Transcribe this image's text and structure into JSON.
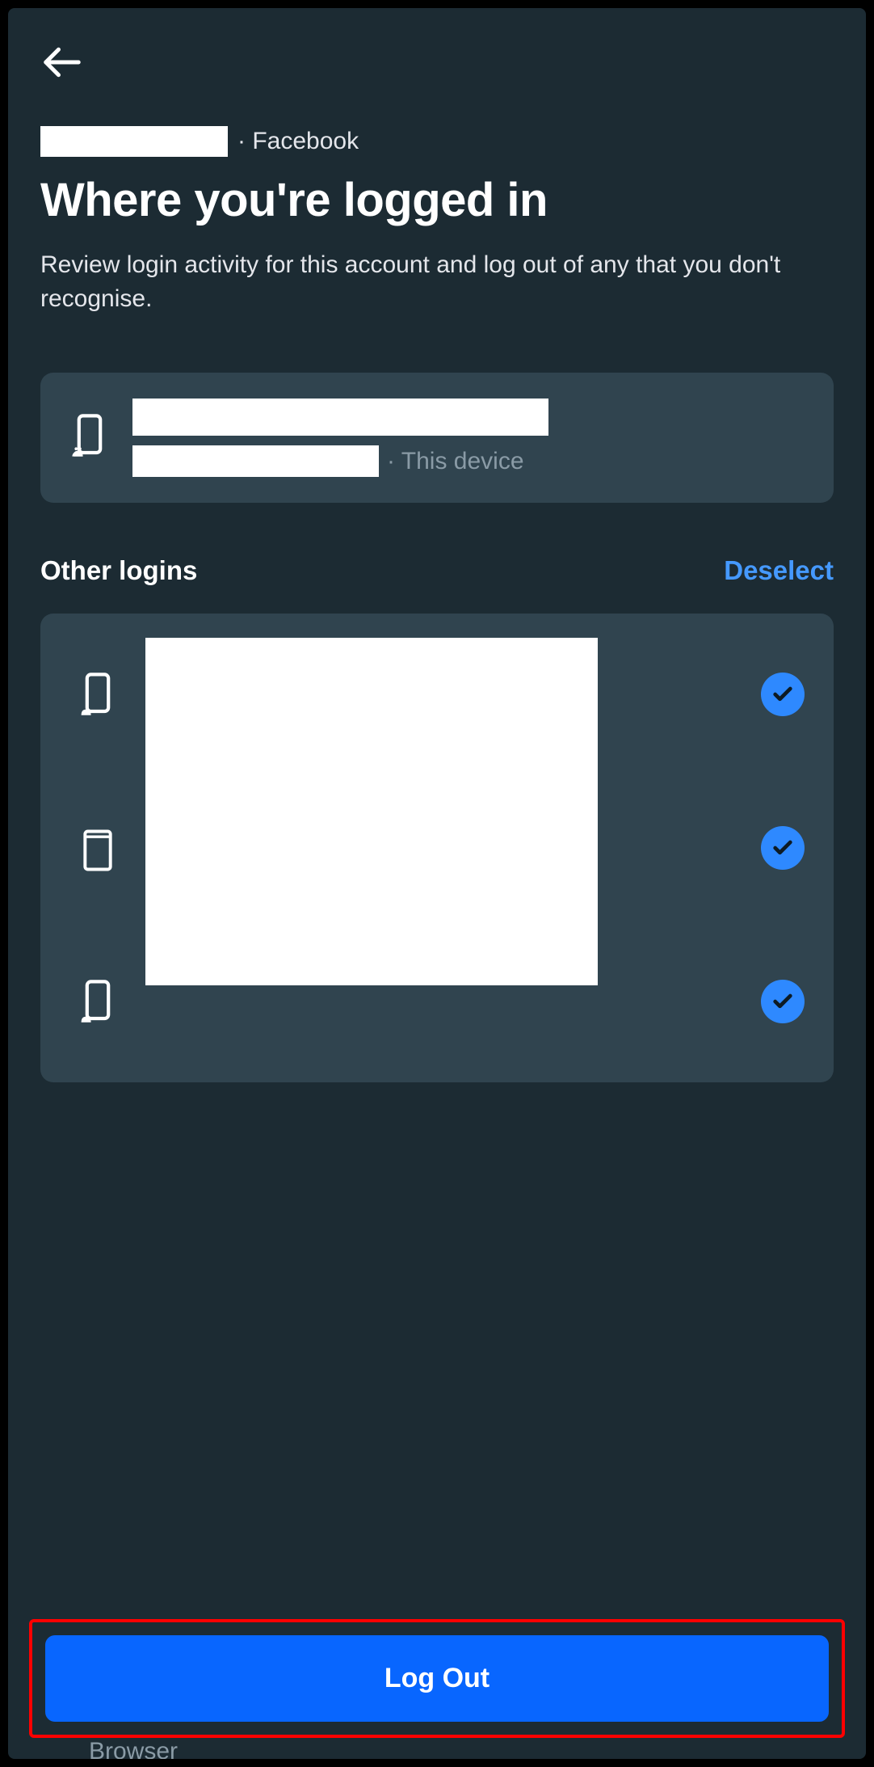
{
  "breadcrumb": {
    "separator_app": "· Facebook"
  },
  "page": {
    "title": "Where you're logged in",
    "description": "Review login activity for this account and log out of any that you don't recognise."
  },
  "current_device": {
    "label_suffix": "· This device",
    "icon": "android-phone-icon"
  },
  "other_logins": {
    "section_title": "Other logins",
    "deselect_label": "Deselect",
    "items": [
      {
        "icon": "android-phone-icon",
        "selected": true
      },
      {
        "icon": "tablet-icon",
        "selected": true
      },
      {
        "icon": "android-phone-icon",
        "selected": true
      }
    ]
  },
  "logout": {
    "button_label": "Log Out"
  },
  "partial_text": "Browser"
}
